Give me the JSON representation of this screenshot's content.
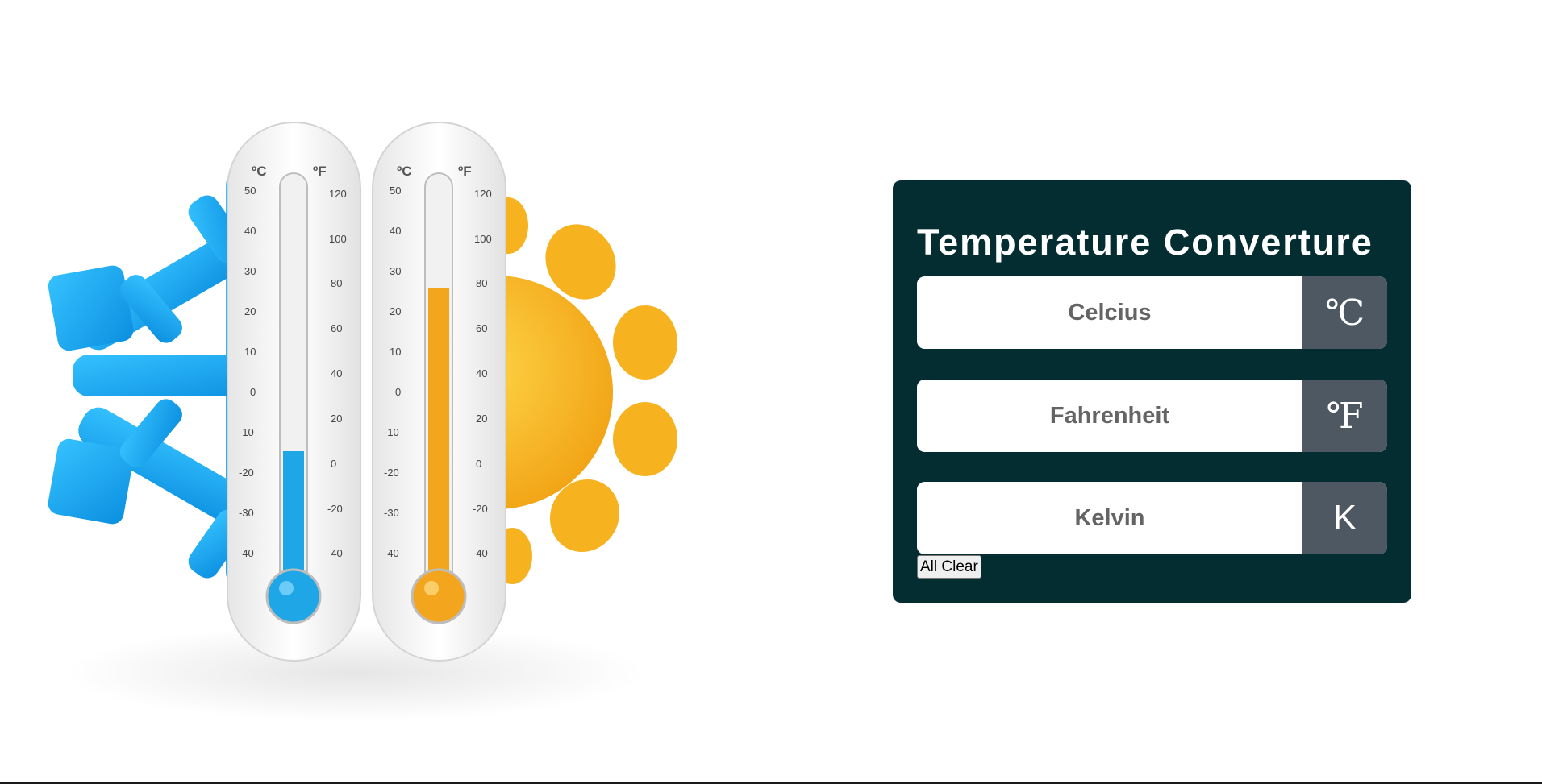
{
  "converter": {
    "title": "Temperature Converture",
    "fields": [
      {
        "placeholder": "Celcius",
        "unit": "℃"
      },
      {
        "placeholder": "Fahrenheit",
        "unit": "℉"
      },
      {
        "placeholder": "Kelvin",
        "unit": "K"
      }
    ],
    "clear_label": "All Clear"
  },
  "illustration": {
    "celsius_symbol": "ºC",
    "fahrenheit_symbol": "ºF",
    "celsius_ticks": [
      "50",
      "40",
      "30",
      "20",
      "10",
      "0",
      "-10",
      "-20",
      "-30",
      "-40"
    ],
    "fahrenheit_ticks": [
      "120",
      "100",
      "80",
      "60",
      "40",
      "20",
      "0",
      "-20",
      "-40"
    ],
    "cold_color": "#1ea6e6",
    "hot_color": "#f4a51e"
  },
  "colors": {
    "card_background": "#032d30",
    "unit_background": "#4e5862"
  }
}
